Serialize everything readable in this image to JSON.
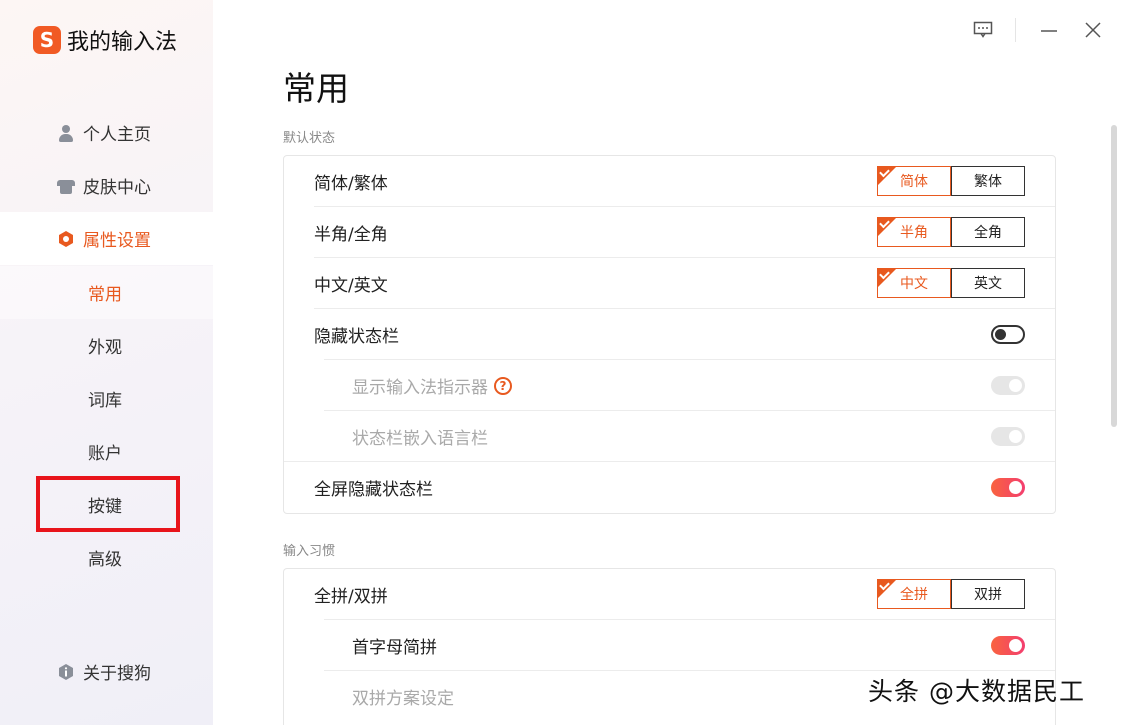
{
  "app": {
    "title": "我的输入法",
    "logo_letter": "S",
    "brand_color": "#f15a24",
    "accent_color": "#e8591f"
  },
  "sidebar": {
    "items": [
      {
        "label": "个人主页",
        "icon": "person-icon"
      },
      {
        "label": "皮肤中心",
        "icon": "shirt-icon"
      },
      {
        "label": "属性设置",
        "icon": "hexagon-settings-icon",
        "active": true
      }
    ],
    "sub_items": [
      {
        "label": "常用",
        "active": true
      },
      {
        "label": "外观"
      },
      {
        "label": "词库"
      },
      {
        "label": "账户"
      },
      {
        "label": "按键",
        "highlighted": true
      },
      {
        "label": "高级"
      }
    ],
    "about": {
      "label": "关于搜狗",
      "icon": "info-icon"
    }
  },
  "window": {
    "feedback_icon": "message-icon",
    "minimize_icon": "minimize-icon",
    "close_icon": "close-icon"
  },
  "page": {
    "title": "常用",
    "sections": [
      {
        "label": "默认状态",
        "rows": [
          {
            "label": "简体/繁体",
            "control": "segmented",
            "options": [
              "简体",
              "繁体"
            ],
            "selected": 0
          },
          {
            "label": "半角/全角",
            "control": "segmented",
            "options": [
              "半角",
              "全角"
            ],
            "selected": 0
          },
          {
            "label": "中文/英文",
            "control": "segmented",
            "options": [
              "中文",
              "英文"
            ],
            "selected": 0
          },
          {
            "label": "隐藏状态栏",
            "control": "toggle",
            "value": false
          },
          {
            "label": "显示输入法指示器",
            "control": "toggle",
            "value": true,
            "disabled": true,
            "sub": true,
            "help": "?"
          },
          {
            "label": "状态栏嵌入语言栏",
            "control": "toggle",
            "value": true,
            "disabled": true,
            "sub": true
          },
          {
            "label": "全屏隐藏状态栏",
            "control": "toggle",
            "value": true
          }
        ]
      },
      {
        "label": "输入习惯",
        "rows": [
          {
            "label": "全拼/双拼",
            "control": "segmented",
            "options": [
              "全拼",
              "双拼"
            ],
            "selected": 0
          },
          {
            "label": "首字母简拼",
            "control": "toggle",
            "value": true,
            "sub": true
          },
          {
            "label": "双拼方案设定",
            "control": "none",
            "disabled": true,
            "sub": true
          }
        ]
      }
    ]
  },
  "watermark": "头条 @大数据民工"
}
